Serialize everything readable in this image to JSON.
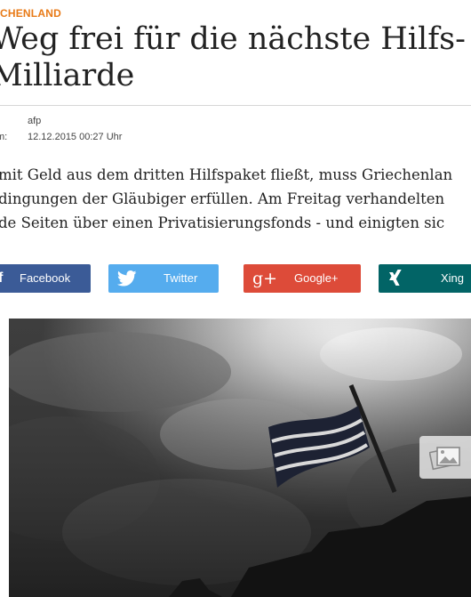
{
  "article": {
    "kicker": "CHENLAND",
    "headline_line1": "Weg frei für die nächste Hilfs-",
    "headline_line2": "Milliarde",
    "meta": {
      "source_value": "afp",
      "date_label": "m:",
      "date_value": "12.12.2015 00:27 Uhr"
    },
    "teaser_lines": [
      "mit Geld aus dem dritten Hilfspaket fließt, muss Griechenlan",
      "dingungen der Gläubiger erfüllen. Am Freitag verhandelten",
      "de Seiten über einen Privatisierungsfonds - und einigten sic"
    ]
  },
  "share": {
    "facebook_label": "Facebook",
    "twitter_label": "Twitter",
    "googleplus_label": "Google+",
    "googleplus_icon_text": "g+",
    "xing_label": "Xing"
  },
  "colors": {
    "kicker": "#e87a17",
    "facebook": "#3b5b97",
    "twitter": "#55acee",
    "googleplus": "#dd4b39",
    "xing": "#026466"
  },
  "icons": [
    "facebook-icon",
    "twitter-icon",
    "googleplus-icon",
    "xing-icon",
    "gallery-icon"
  ]
}
